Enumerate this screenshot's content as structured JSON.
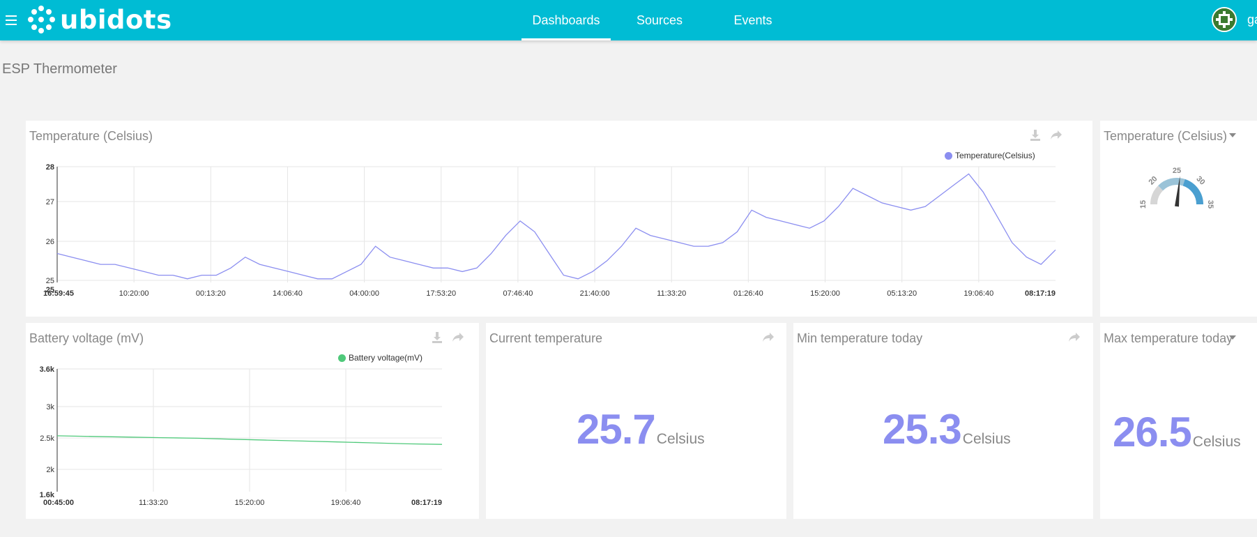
{
  "app": {
    "brand": "ubidots",
    "user_initials": "ga"
  },
  "nav": {
    "items": [
      {
        "label": "Dashboards",
        "active": true
      },
      {
        "label": "Sources",
        "active": false
      },
      {
        "label": "Events",
        "active": false
      }
    ]
  },
  "page": {
    "title": "ESP Thermometer"
  },
  "widgets": {
    "temp_chart": {
      "title": "Temperature (Celsius)",
      "legend": "Temperature(Celsius)",
      "color": "#8b8ef0"
    },
    "gauge": {
      "title": "Temperature (Celsius)",
      "ticks": [
        "15",
        "20",
        "25",
        "30",
        "35"
      ],
      "value": 25.7
    },
    "battery_chart": {
      "title": "Battery voltage (mV)",
      "legend": "Battery voltage(mV)",
      "color": "#4fc97a"
    },
    "current_temp": {
      "title": "Current temperature",
      "value": "25.7",
      "unit": "Celsius"
    },
    "min_temp": {
      "title": "Min temperature today",
      "value": "25.3",
      "unit": "Celsius"
    },
    "max_temp": {
      "title": "Max temperature today",
      "value": "26.5",
      "unit": "Celsius"
    }
  },
  "chart_data": [
    {
      "type": "line",
      "title": "Temperature (Celsius)",
      "x": [
        "16:59:45",
        "10:20:00",
        "00:13:20",
        "14:06:40",
        "04:00:00",
        "17:53:20",
        "07:46:40",
        "21:40:00",
        "11:33:20",
        "01:26:40",
        "15:20:00",
        "05:13:20",
        "19:06:40",
        "08:17:19"
      ],
      "y_ticks": [
        "28",
        "27",
        "26",
        "25",
        "25"
      ],
      "ylim": [
        24.8,
        28
      ],
      "series": [
        {
          "name": "Temperature(Celsius)",
          "values": [
            25.6,
            25.5,
            25.4,
            25.3,
            25.3,
            25.2,
            25.1,
            25.0,
            25.0,
            24.9,
            25.0,
            25.0,
            25.2,
            25.5,
            25.3,
            25.2,
            25.1,
            25.0,
            24.9,
            24.9,
            25.1,
            25.3,
            25.8,
            25.5,
            25.4,
            25.3,
            25.2,
            25.2,
            25.1,
            25.2,
            25.6,
            26.1,
            26.5,
            26.2,
            25.6,
            25.0,
            24.9,
            25.1,
            25.4,
            25.8,
            26.3,
            26.1,
            26.0,
            25.9,
            25.8,
            25.8,
            25.9,
            26.2,
            26.8,
            26.6,
            26.5,
            26.4,
            26.3,
            26.5,
            26.9,
            27.4,
            27.2,
            27.0,
            26.9,
            26.8,
            26.9,
            27.2,
            27.5,
            27.8,
            27.3,
            26.6,
            25.9,
            25.5,
            25.3,
            25.7
          ]
        }
      ],
      "grid": true
    },
    {
      "type": "line",
      "title": "Battery voltage (mV)",
      "x": [
        "00:45:00",
        "11:33:20",
        "15:20:00",
        "19:06:40",
        "08:17:19"
      ],
      "y_ticks": [
        "3.6k",
        "3k",
        "2.5k",
        "2k",
        "1.6k"
      ],
      "ylim": [
        1600,
        3600
      ],
      "series": [
        {
          "name": "Battery voltage(mV)",
          "values": [
            2510,
            2500,
            2490,
            2480,
            2470,
            2455,
            2440,
            2425,
            2410,
            2395,
            2380,
            2370
          ]
        }
      ],
      "grid": true
    }
  ]
}
